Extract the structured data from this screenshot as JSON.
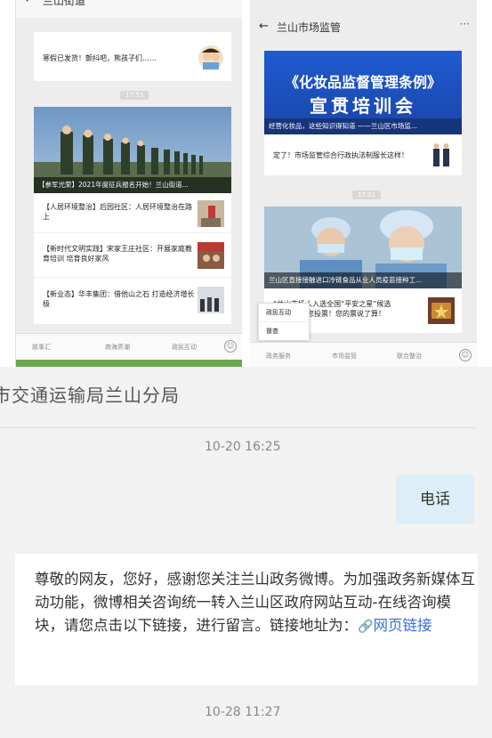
{
  "left_chat": {
    "title": "兰山街道",
    "back": "←",
    "more": "···",
    "msg1": "寒假已发货！颤抖吧，熊孩子们……",
    "time1": "17:53",
    "img_caption": "【参军光荣】2021年度征兵报名开始！兰山街道...",
    "items": [
      {
        "text": "【人居环境整治】后园社区：人居环境整治在路上"
      },
      {
        "text": "【新时代文明实践】宋家王庄社区：开展家庭教育培训 培育良好家风"
      },
      {
        "text": "【新业态】华丰集团：借他山之石 打造经济增长极"
      }
    ],
    "menu": [
      "故事汇",
      "商海弄潮",
      "政民互动"
    ]
  },
  "right_chat": {
    "title": "兰山市场监管",
    "back": "←",
    "more": "···",
    "banner_line1": "《化妆品监督管理条例》",
    "banner_line2": "宣贯培训会",
    "banner_caption": "经营化妆品，这些知识得知道 ——兰山区市场监...",
    "msg1": "定了！市场监管综合行政执法制服长这样！",
    "time1": "17:21",
    "img_caption": "兰山区直接接触进口冷链食品从业人员疫苗接种工...",
    "msg2_a": "“兰山市场人入选全国“平安之星”候选",
    "msg2_b": "邀您投票！您的票说了算！",
    "popup": [
      "政民互动",
      "督查"
    ],
    "menu": [
      "政务服务",
      "市场监管",
      "联合整治"
    ]
  },
  "chat": {
    "title": "市交通运输局兰山分局",
    "time1": "10-20 16:25",
    "bubble": "电话",
    "message": "尊敬的网友，您好，感谢您关注兰山政务微博。为加强政务新媒体互动功能，微博相关咨询统一转入兰山区政府网站互动-在线咨询模块，请您点击以下链接，进行留言。链接地址为：",
    "link": "网页链接",
    "time2": "10-28 11:27"
  }
}
